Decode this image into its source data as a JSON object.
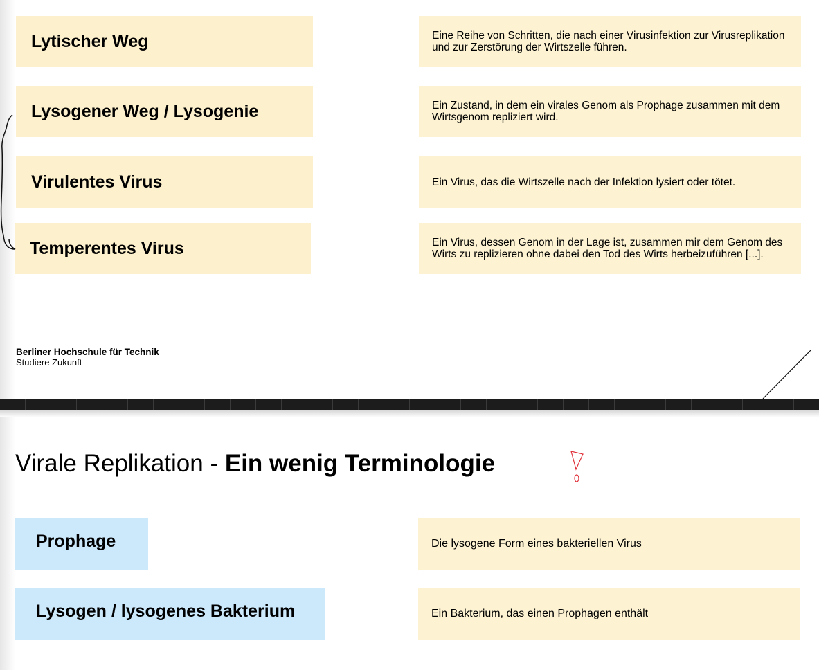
{
  "upper_terms": [
    {
      "term": "Lytischer Weg",
      "definition": "Eine Reihe von Schritten, die nach einer Virusinfektion zur Virusreplikation und zur Zerstörung der Wirtszelle führen."
    },
    {
      "term": "Lysogener Weg / Lysogenie",
      "definition": "Ein Zustand, in dem ein virales Genom als Prophage zusammen mit dem Wirtsgenom repliziert wird."
    },
    {
      "term": "Virulentes Virus",
      "definition": "Ein Virus, das die Wirtszelle nach der Infektion lysiert oder tötet."
    },
    {
      "term": "Temperentes Virus",
      "definition": "Ein Virus, dessen Genom in der Lage ist, zusammen mir dem Genom des Wirts zu replizieren ohne dabei den Tod des Wirts herbeizuführen [...]."
    }
  ],
  "footer": {
    "institution": "Berliner Hochschule für Technik",
    "tagline": "Studiere Zukunft"
  },
  "slide2": {
    "title_regular": "Virale Replikation - ",
    "title_bold": "Ein wenig Terminologie",
    "terms": [
      {
        "term": "Prophage",
        "definition": "Die lysogene Form eines bakteriellen Virus"
      },
      {
        "term": "Lysogen / lysogenes Bakterium",
        "definition": "Ein Bakterium, das einen Prophagen enthält"
      }
    ]
  },
  "colors": {
    "term_card": "#fdf0cc",
    "definition_card": "#fdf3d2",
    "term_card_blue": "#cce8fb",
    "annotation_red": "#e0303a",
    "annotation_black": "#111111"
  }
}
